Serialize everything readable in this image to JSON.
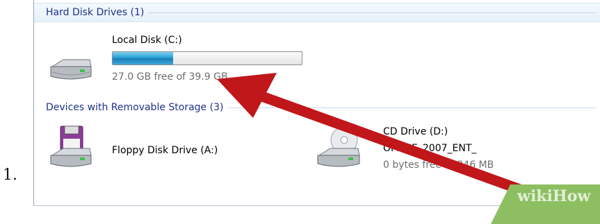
{
  "step": {
    "number": "1."
  },
  "groups": {
    "hard_disks": {
      "title": "Hard Disk Drives (1)"
    },
    "removable": {
      "title": "Devices with Removable Storage (3)"
    }
  },
  "drives": {
    "local_disk": {
      "label": "Local Disk (C:)",
      "free_text": "27.0 GB free of 39.9 GB",
      "used_fraction": 0.32,
      "icon": "hard-disk-icon"
    },
    "floppy": {
      "label": "Floppy Disk Drive (A:)",
      "icon": "floppy-drive-icon"
    },
    "cd_drive": {
      "label": "CD Drive (D:)",
      "volume": "OFFICE_2007_ENT_",
      "free_text": "0 bytes free of 946 MB",
      "icon": "cd-drive-icon"
    }
  },
  "annotation": {
    "color": "#c0171b"
  },
  "watermark": {
    "text": "wikiHow",
    "wiki": "wiki",
    "how": "How",
    "color": "#8dbf62"
  }
}
